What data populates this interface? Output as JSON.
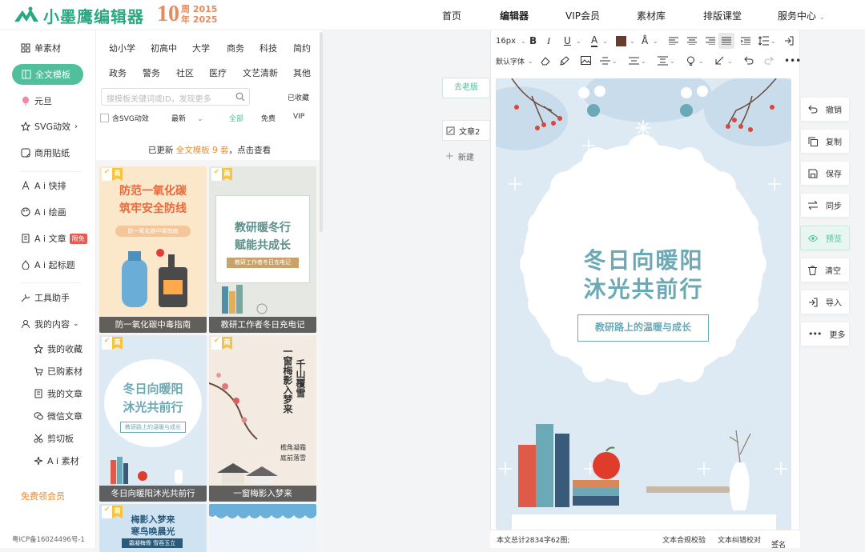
{
  "brand": {
    "name": "小墨鹰编辑器",
    "anniv_num": "10",
    "anniv_line1": "周 2015",
    "anniv_line2": "年 2025",
    "accent": "#4fbf9c"
  },
  "nav": {
    "home": "首页",
    "editor": "编辑器",
    "vip": "VIP会员",
    "materials": "素材库",
    "course": "排版课堂",
    "service": "服务中心"
  },
  "sidebar": {
    "items": [
      "单素材",
      "全文模板",
      "元旦",
      "SVG动效",
      "商用贴纸",
      "A i 快排",
      "A i 绘画",
      "A i 文章",
      "A i 起标题",
      "工具助手",
      "我的内容"
    ],
    "ai_article_badge": "限免",
    "sub": [
      "我的收藏",
      "已购素材",
      "我的文章",
      "微信文章",
      "剪切板",
      "A i 素材"
    ],
    "free_vip": "免费领会员",
    "icp": "粤ICP备16024496号-1"
  },
  "categories": [
    "幼小学",
    "初高中",
    "大学",
    "商务",
    "科技",
    "简约",
    "政务",
    "警务",
    "社区",
    "医疗",
    "文艺清新",
    "其他"
  ],
  "search": {
    "placeholder": "搜模板关键词或ID，发现更多",
    "favorites": "已收藏"
  },
  "filters": {
    "svg": "含SVG动效",
    "sort": "最新",
    "all": "全部",
    "free": "免费",
    "vip": "VIP"
  },
  "notice": {
    "pre": "已更新",
    "highlight": "全文模板 9 套",
    "post": "，点击查看"
  },
  "templates": [
    {
      "caption": "防一氧化碳中毒指南",
      "title1": "防范一氧化碳",
      "title2": "筑牢安全防线",
      "sub": "防一氧化碳中毒指南"
    },
    {
      "caption": "教研工作者冬日充电记",
      "title1": "教研暖冬行",
      "title2": "赋能共成长",
      "sub": "教研工作者冬日充电记"
    },
    {
      "caption": "冬日向暖阳沐光共前行",
      "title1": "冬日向暖阳",
      "title2": "沐光共前行",
      "sub": "教研路上的温暖与成长"
    },
    {
      "caption": "一窗梅影入梦来",
      "title1": "一窗梅影入梦来",
      "title2": "千山覆雪",
      "sub1": "檐角凝霜",
      "sub2": "庭前落雪"
    },
    {
      "title1": "梅影入梦来",
      "title2": "寒鸟唤晨光",
      "sub": "霜凝梅骨 雪吞玉立"
    },
    {}
  ],
  "tag_label": "商",
  "workspace": {
    "old_version": "去老版",
    "article_tab": "文章2",
    "new_btn": "新建"
  },
  "toolbar": {
    "font_size": "16px",
    "font_family": "默认字体"
  },
  "document": {
    "title1": "冬日向暖阳",
    "title2": "沐光共前行",
    "subtitle": "教研路上的温暖与成长"
  },
  "status": {
    "stats": "本文总计2834字62图;",
    "compliance": "文本合规校验",
    "proofread": "文本纠错校对",
    "signature": "签名"
  },
  "actions": [
    "撤销",
    "复制",
    "保存",
    "同步",
    "预览",
    "清空",
    "导入",
    "更多"
  ]
}
